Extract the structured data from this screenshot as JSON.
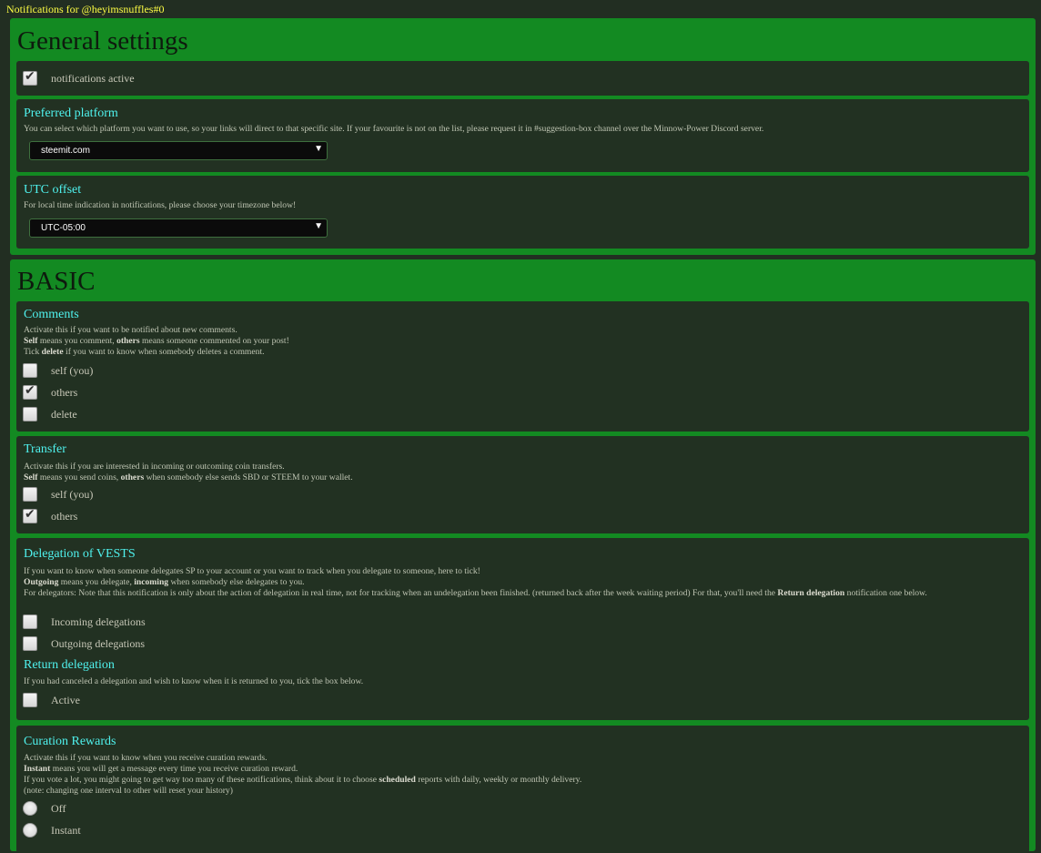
{
  "header": {
    "title": "Notifications for @heyimsnuffles#0"
  },
  "general": {
    "heading": "General settings",
    "notifications_active": {
      "label": "notifications active",
      "checked": true
    },
    "platform": {
      "title": "Preferred platform",
      "desc": "You can select which platform you want to use, so your links will direct to that specific site. If your favourite is not on the list, please request it in #suggestion-box channel over the Minnow-Power Discord server.",
      "selected": "steemit.com"
    },
    "utc": {
      "title": "UTC offset",
      "desc": "For local time indication in notifications, please choose your timezone below!",
      "selected": "UTC-05:00"
    }
  },
  "basic": {
    "heading": "BASIC",
    "comments": {
      "title": "Comments",
      "desc1": "Activate this if you want to be notified about new comments.",
      "desc2_b1": "Self",
      "desc2_t1": " means you comment, ",
      "desc2_b2": "others",
      "desc2_t2": " means someone commented on your post!",
      "desc3_t1": "Tick ",
      "desc3_b1": "delete",
      "desc3_t2": " if you want to know when somebody deletes a comment.",
      "opt_self": {
        "label": "self (you)",
        "checked": false
      },
      "opt_others": {
        "label": "others",
        "checked": true
      },
      "opt_delete": {
        "label": "delete",
        "checked": false
      }
    },
    "transfer": {
      "title": "Transfer",
      "desc1": "Activate this if you are interested in incoming or outcoming coin transfers.",
      "desc2_b1": "Self",
      "desc2_t1": " means you send coins, ",
      "desc2_b2": "others",
      "desc2_t2": " when somebody else sends SBD or STEEM to your wallet.",
      "opt_self": {
        "label": "self (you)",
        "checked": false
      },
      "opt_others": {
        "label": "others",
        "checked": true
      }
    },
    "delegation": {
      "title": "Delegation of VESTS",
      "desc1": "If you want to know when someone delegates SP to your account or you want to track when you delegate to someone, here to tick!",
      "desc2_b1": "Outgoing",
      "desc2_t1": " means you delegate, ",
      "desc2_b2": "incoming",
      "desc2_t2": " when somebody else delegates to you.",
      "desc3_t1": "For delegators: Note that this notification is only about the action of delegation in real time, not for tracking when an undelegation been finished. (returned back after the week waiting period) For that, you'll need the ",
      "desc3_b1": "Return delegation",
      "desc3_t2": " notification one below.",
      "opt_incoming": {
        "label": "Incoming delegations",
        "checked": false
      },
      "opt_outgoing": {
        "label": "Outgoing delegations",
        "checked": false
      },
      "return_title": "Return delegation",
      "return_desc": "If you had canceled a delegation and wish to know when it is returned to you, tick the box below.",
      "opt_active": {
        "label": "Active",
        "checked": false
      }
    },
    "curation": {
      "title": "Curation Rewards",
      "desc1": "Activate this if you want to know when you receive curation rewards.",
      "desc2_b1": "Instant",
      "desc2_t1": " means you will get a message every time you receive curation reward.",
      "desc3_t1": "If you vote a lot, you might going to get way too many of these notifications, think about it to choose ",
      "desc3_b1": "scheduled",
      "desc3_t2": " reports with daily, weekly or monthly delivery.",
      "desc4": "(note: changing one interval to other will reset your history)",
      "opt_off": {
        "label": "Off"
      },
      "opt_instant": {
        "label": "Instant"
      }
    }
  },
  "colors": {
    "page_bg": "#222e22",
    "section_bg": "#138a22",
    "card_bg": "#223122",
    "title_cyan": "#4ff2ee",
    "header_yellow": "#ffff44"
  }
}
